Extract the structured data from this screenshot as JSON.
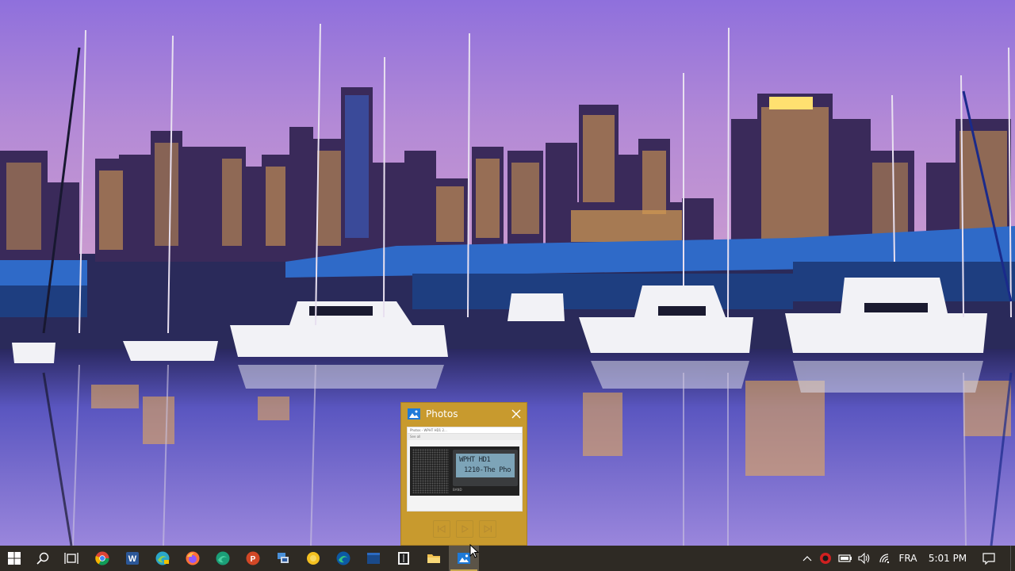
{
  "preview": {
    "app_title": "Photos",
    "thumbnail": {
      "title_bar_text": "Photos - WPHT HD1 2...",
      "toolbar_text": "See all   ",
      "lcd_line1": "WPHT HD1",
      "lcd_line2": "1210-The Pho",
      "band_label": "BAND"
    },
    "controls": [
      "previous",
      "play",
      "next"
    ]
  },
  "taskbar": {
    "apps": [
      {
        "name": "start-button",
        "icon": "windows-logo"
      },
      {
        "name": "search-button",
        "icon": "search-icon"
      },
      {
        "name": "task-view-button",
        "icon": "task-view-icon"
      },
      {
        "name": "chrome",
        "icon": "chrome-icon"
      },
      {
        "name": "word",
        "icon": "word-icon"
      },
      {
        "name": "edge-canary",
        "icon": "edge-canary-icon"
      },
      {
        "name": "firefox",
        "icon": "firefox-icon"
      },
      {
        "name": "edge-dev",
        "icon": "edge-dev-icon"
      },
      {
        "name": "powerpoint",
        "icon": "powerpoint-icon"
      },
      {
        "name": "remote-app",
        "icon": "remote-app-icon"
      },
      {
        "name": "yellow-app",
        "icon": "yellow-circle-icon"
      },
      {
        "name": "edge",
        "icon": "edge-icon"
      },
      {
        "name": "blue-window-app",
        "icon": "blue-window-icon"
      },
      {
        "name": "terminal-app",
        "icon": "terminal-icon"
      },
      {
        "name": "file-explorer",
        "icon": "folder-icon"
      },
      {
        "name": "photos",
        "icon": "photos-icon",
        "active": true
      }
    ],
    "tray": {
      "language": "FRA",
      "time": "5:01 PM"
    }
  },
  "colors": {
    "preview_bg": "#c89a2e",
    "taskbar_bg": "#2e2a24",
    "accent": "#c9a850"
  }
}
